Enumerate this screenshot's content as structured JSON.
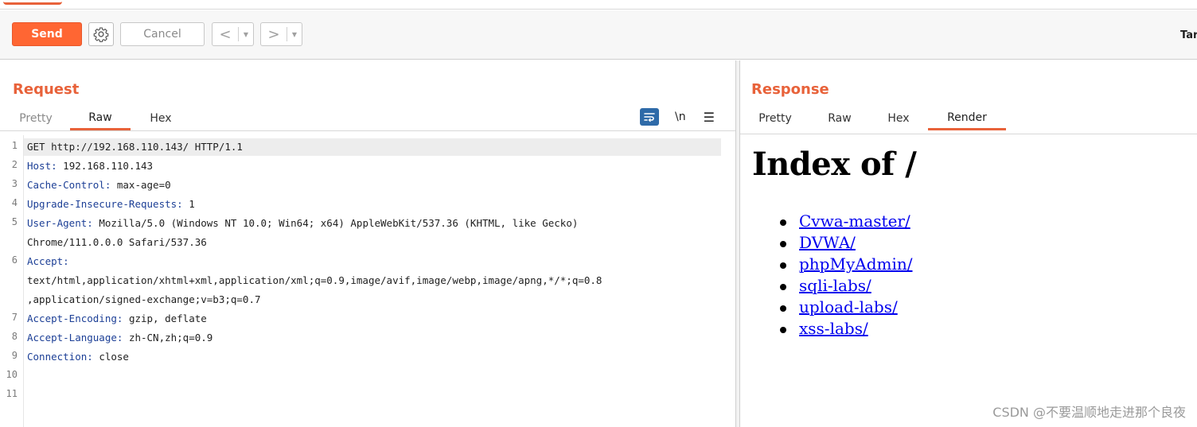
{
  "toolbar": {
    "send_label": "Send",
    "cancel_label": "Cancel",
    "back_label": "<",
    "forward_label": ">",
    "dropdown_glyph": "▼",
    "target_label": "Tar",
    "icons": {
      "settings": "gear-icon",
      "back": "chevron-left-icon",
      "forward": "chevron-right-icon"
    }
  },
  "request": {
    "title": "Request",
    "tabs": [
      {
        "label": "Pretty",
        "active": false
      },
      {
        "label": "Raw",
        "active": true
      },
      {
        "label": "Hex",
        "active": false
      }
    ],
    "tools": {
      "wrap_icon": "wrap-lines-icon",
      "newline_label": "\\n",
      "menu_icon": "hamburger-menu-icon"
    },
    "line_numbers": [
      "1",
      "2",
      "3",
      "4",
      "5",
      "6",
      "7",
      "8",
      "9",
      "10",
      "11"
    ],
    "lines": [
      {
        "name": "",
        "value": "GET http://192.168.110.143/ HTTP/1.1"
      },
      {
        "name": "Host:",
        "value": " 192.168.110.143"
      },
      {
        "name": "Cache-Control:",
        "value": " max-age=0"
      },
      {
        "name": "Upgrade-Insecure-Requests:",
        "value": " 1"
      },
      {
        "name": "User-Agent:",
        "value": " Mozilla/5.0 (Windows NT 10.0; Win64; x64) AppleWebKit/537.36 (KHTML, like Gecko)"
      },
      {
        "name": "",
        "value": "Chrome/111.0.0.0 Safari/537.36"
      },
      {
        "name": "Accept:",
        "value": ""
      },
      {
        "name": "",
        "value": "text/html,application/xhtml+xml,application/xml;q=0.9,image/avif,image/webp,image/apng,*/*;q=0.8"
      },
      {
        "name": "",
        "value": ",application/signed-exchange;v=b3;q=0.7"
      },
      {
        "name": "Accept-Encoding:",
        "value": " gzip, deflate"
      },
      {
        "name": "Accept-Language:",
        "value": " zh-CN,zh;q=0.9"
      },
      {
        "name": "Connection:",
        "value": " close"
      }
    ]
  },
  "response": {
    "title": "Response",
    "tabs": [
      {
        "label": "Pretty",
        "active": false
      },
      {
        "label": "Raw",
        "active": false
      },
      {
        "label": "Hex",
        "active": false
      },
      {
        "label": "Render",
        "active": true
      }
    ],
    "render": {
      "heading": "Index of /",
      "links": [
        "Cvwa-master/",
        "DVWA/",
        "phpMyAdmin/",
        "sqli-labs/",
        "upload-labs/",
        "xss-labs/"
      ]
    }
  },
  "watermark": "CSDN @不要温顺地走进那个良夜",
  "colors": {
    "accent": "#e8623a",
    "send": "#ff6633",
    "link": "#0000ee",
    "header_name": "#1c3f96",
    "tool_blue": "#2e6aa8"
  }
}
